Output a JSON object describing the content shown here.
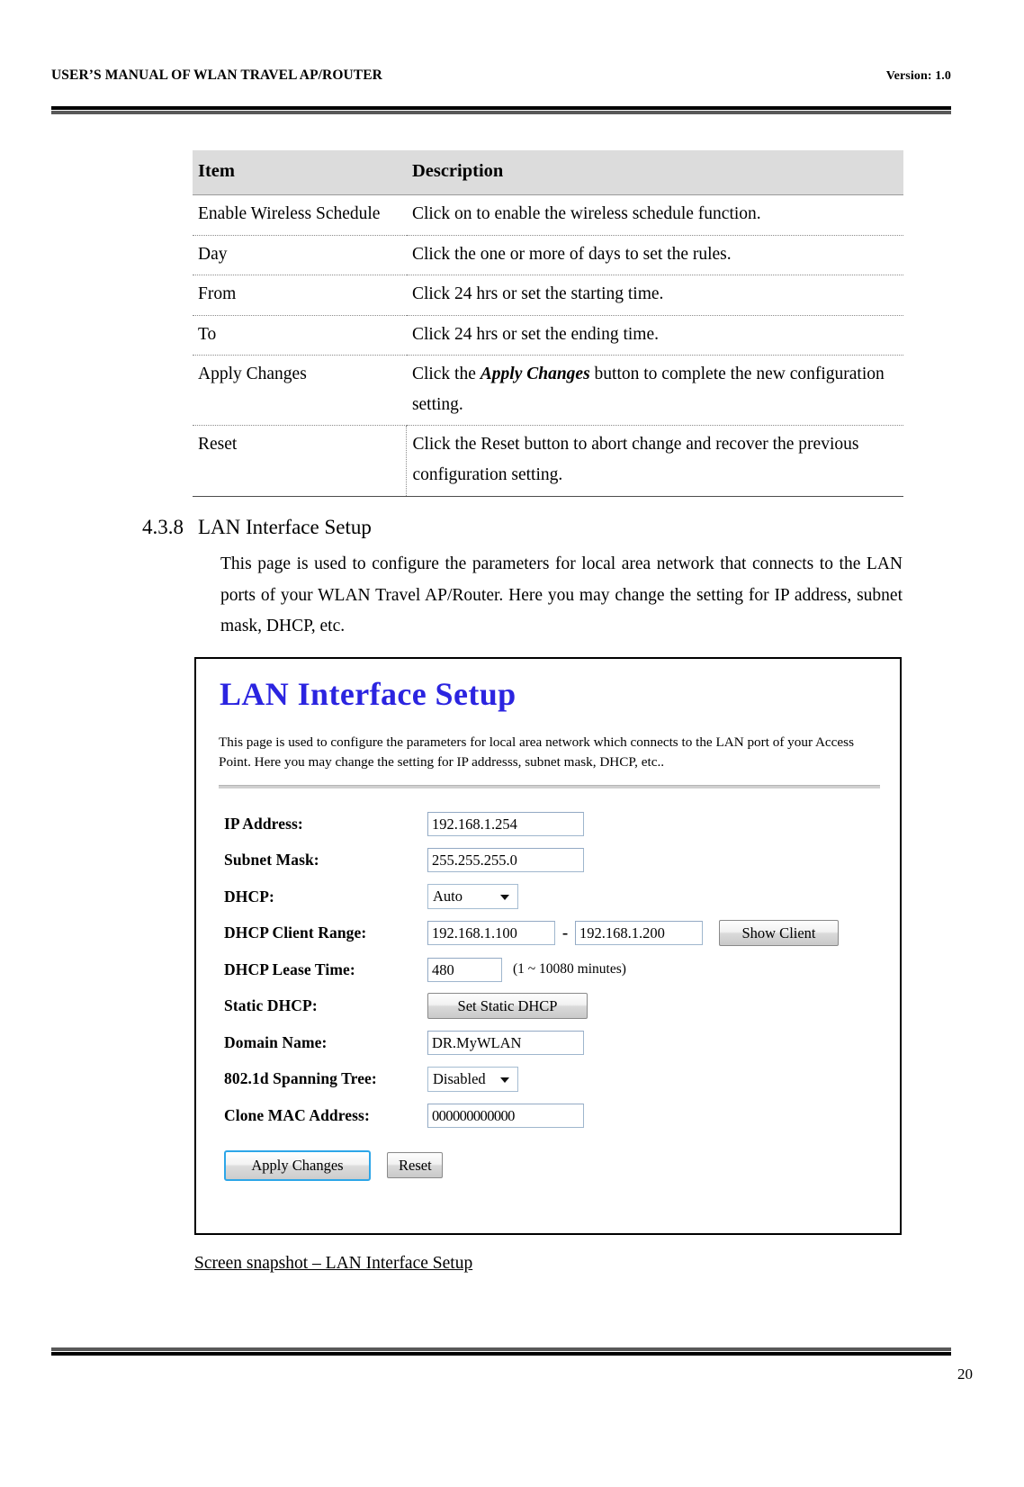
{
  "header": {
    "title": "USER’S MANUAL OF WLAN TRAVEL AP/ROUTER",
    "version": "Version: 1.0"
  },
  "item_table": {
    "columns": [
      "Item",
      "Description"
    ],
    "rows": [
      {
        "item": "Enable Wireless Schedule",
        "desc": "Click on to enable the wireless schedule function."
      },
      {
        "item": "Day",
        "desc": "Click the one or more of days to set the rules."
      },
      {
        "item": "From",
        "desc": "Click 24 hrs or set the starting time."
      },
      {
        "item": "To",
        "desc": "Click 24 hrs or set the ending time."
      },
      {
        "item": "Apply Changes",
        "desc_pre": "Click the ",
        "desc_em": "Apply Changes",
        "desc_post": " button to complete the new configuration setting."
      },
      {
        "item": "Reset",
        "desc": "Click the Reset button to abort change and recover the previous configuration setting."
      }
    ]
  },
  "section": {
    "number": "4.3.8",
    "title": "LAN Interface Setup",
    "body": "This page is used to configure the parameters for local area network that connects to the LAN ports of your WLAN Travel AP/Router. Here you may change the setting for IP address, subnet mask, DHCP, etc."
  },
  "screenshot": {
    "title": "LAN Interface Setup",
    "description": "This page is used to configure the parameters for local area network which connects to the LAN port of your Access Point. Here you may change the setting for IP addresss, subnet mask, DHCP, etc..",
    "title_color": "#2b24e0",
    "fields": {
      "ip_address": {
        "label": "IP Address:",
        "value": "192.168.1.254"
      },
      "subnet_mask": {
        "label": "Subnet Mask:",
        "value": "255.255.255.0"
      },
      "dhcp": {
        "label": "DHCP:",
        "value": "Auto"
      },
      "dhcp_client_range": {
        "label": "DHCP Client Range:",
        "start": "192.168.1.100",
        "separator": "-",
        "end": "192.168.1.200",
        "button": "Show Client"
      },
      "dhcp_lease_time": {
        "label": "DHCP Lease Time:",
        "value": "480",
        "hint": "(1 ~ 10080 minutes)"
      },
      "static_dhcp": {
        "label": "Static DHCP:",
        "button": "Set Static DHCP"
      },
      "domain_name": {
        "label": "Domain Name:",
        "value": "DR.MyWLAN"
      },
      "spanning_tree": {
        "label": "802.1d Spanning Tree:",
        "value": "Disabled"
      },
      "clone_mac": {
        "label": "Clone MAC Address:",
        "value": "000000000000"
      }
    },
    "actions": {
      "apply": "Apply Changes",
      "reset": "Reset"
    }
  },
  "caption": "Screen snapshot – LAN Interface Setup",
  "footer": {
    "page_number": "20"
  }
}
